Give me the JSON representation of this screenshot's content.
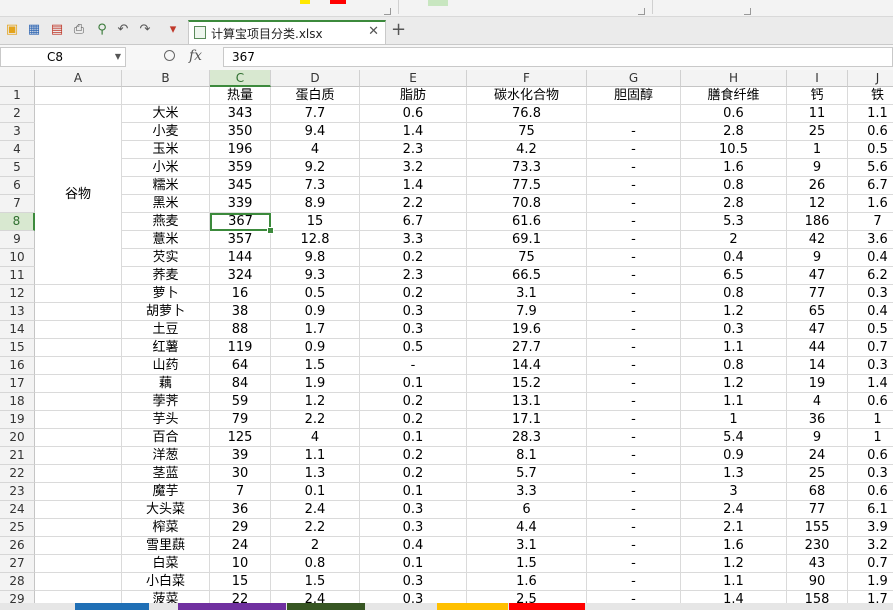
{
  "window": {
    "active_tab_title": "计算宝项目分类.xlsx"
  },
  "formula_bar": {
    "name_box": "C8",
    "fx_label": "fx",
    "formula_value": "367"
  },
  "grid": {
    "columns": [
      "A",
      "B",
      "C",
      "D",
      "E",
      "F",
      "G",
      "H",
      "I",
      "J"
    ],
    "active_column": "C",
    "active_row": 8,
    "header_row": [
      "",
      "",
      "热量",
      "蛋白质",
      "脂肪",
      "碳水化合物",
      "胆固醇",
      "膳食纤维",
      "钙",
      "铁"
    ],
    "category_label": "谷物",
    "rows": [
      {
        "num": 2,
        "name": "大米",
        "values": [
          "343",
          "7.7",
          "0.6",
          "76.8",
          "",
          "0.6",
          "11",
          "1.1"
        ]
      },
      {
        "num": 3,
        "name": "小麦",
        "values": [
          "350",
          "9.4",
          "1.4",
          "75",
          "-",
          "2.8",
          "25",
          "0.6"
        ]
      },
      {
        "num": 4,
        "name": "玉米",
        "values": [
          "196",
          "4",
          "2.3",
          "4.2",
          "-",
          "10.5",
          "1",
          "0.5"
        ]
      },
      {
        "num": 5,
        "name": "小米",
        "values": [
          "359",
          "9.2",
          "3.2",
          "73.3",
          "-",
          "1.6",
          "9",
          "5.6"
        ]
      },
      {
        "num": 6,
        "name": "糯米",
        "values": [
          "345",
          "7.3",
          "1.4",
          "77.5",
          "-",
          "0.8",
          "26",
          "6.7"
        ]
      },
      {
        "num": 7,
        "name": "黑米",
        "values": [
          "339",
          "8.9",
          "2.2",
          "70.8",
          "-",
          "2.8",
          "12",
          "1.6"
        ]
      },
      {
        "num": 8,
        "name": "燕麦",
        "values": [
          "367",
          "15",
          "6.7",
          "61.6",
          "-",
          "5.3",
          "186",
          "7"
        ]
      },
      {
        "num": 9,
        "name": "薏米",
        "values": [
          "357",
          "12.8",
          "3.3",
          "69.1",
          "-",
          "2",
          "42",
          "3.6"
        ]
      },
      {
        "num": 10,
        "name": "芡实",
        "values": [
          "144",
          "9.8",
          "0.2",
          "75",
          "-",
          "0.4",
          "9",
          "0.4"
        ]
      },
      {
        "num": 11,
        "name": "荞麦",
        "values": [
          "324",
          "9.3",
          "2.3",
          "66.5",
          "-",
          "6.5",
          "47",
          "6.2"
        ]
      },
      {
        "num": 12,
        "name": "萝卜",
        "values": [
          "16",
          "0.5",
          "0.2",
          "3.1",
          "-",
          "0.8",
          "77",
          "0.3"
        ]
      },
      {
        "num": 13,
        "name": "胡萝卜",
        "values": [
          "38",
          "0.9",
          "0.3",
          "7.9",
          "-",
          "1.2",
          "65",
          "0.4"
        ]
      },
      {
        "num": 14,
        "name": "土豆",
        "values": [
          "88",
          "1.7",
          "0.3",
          "19.6",
          "-",
          "0.3",
          "47",
          "0.5"
        ]
      },
      {
        "num": 15,
        "name": "红薯",
        "values": [
          "119",
          "0.9",
          "0.5",
          "27.7",
          "-",
          "1.1",
          "44",
          "0.7"
        ]
      },
      {
        "num": 16,
        "name": "山药",
        "values": [
          "64",
          "1.5",
          "-",
          "14.4",
          "-",
          "0.8",
          "14",
          "0.3"
        ]
      },
      {
        "num": 17,
        "name": "藕",
        "values": [
          "84",
          "1.9",
          "0.1",
          "15.2",
          "-",
          "1.2",
          "19",
          "1.4"
        ]
      },
      {
        "num": 18,
        "name": "荸荠",
        "values": [
          "59",
          "1.2",
          "0.2",
          "13.1",
          "-",
          "1.1",
          "4",
          "0.6"
        ]
      },
      {
        "num": 19,
        "name": "芋头",
        "values": [
          "79",
          "2.2",
          "0.2",
          "17.1",
          "-",
          "1",
          "36",
          "1"
        ]
      },
      {
        "num": 20,
        "name": "百合",
        "values": [
          "125",
          "4",
          "0.1",
          "28.3",
          "-",
          "5.4",
          "9",
          "1"
        ]
      },
      {
        "num": 21,
        "name": "洋葱",
        "values": [
          "39",
          "1.1",
          "0.2",
          "8.1",
          "-",
          "0.9",
          "24",
          "0.6"
        ]
      },
      {
        "num": 22,
        "name": "茎蓝",
        "values": [
          "30",
          "1.3",
          "0.2",
          "5.7",
          "-",
          "1.3",
          "25",
          "0.3"
        ]
      },
      {
        "num": 23,
        "name": "魔芋",
        "values": [
          "7",
          "0.1",
          "0.1",
          "3.3",
          "-",
          "3",
          "68",
          "0.6"
        ]
      },
      {
        "num": 24,
        "name": "大头菜",
        "values": [
          "36",
          "2.4",
          "0.3",
          "6",
          "-",
          "2.4",
          "77",
          "6.1"
        ]
      },
      {
        "num": 25,
        "name": "榨菜",
        "values": [
          "29",
          "2.2",
          "0.3",
          "4.4",
          "-",
          "2.1",
          "155",
          "3.9"
        ]
      },
      {
        "num": 26,
        "name": "雪里蕻",
        "values": [
          "24",
          "2",
          "0.4",
          "3.1",
          "-",
          "1.6",
          "230",
          "3.2"
        ]
      },
      {
        "num": 27,
        "name": "白菜",
        "values": [
          "10",
          "0.8",
          "0.1",
          "1.5",
          "-",
          "1.2",
          "43",
          "0.7"
        ]
      },
      {
        "num": 28,
        "name": "小白菜",
        "values": [
          "15",
          "1.5",
          "0.3",
          "1.6",
          "-",
          "1.1",
          "90",
          "1.9"
        ]
      },
      {
        "num": 29,
        "name": "菠菜",
        "values": [
          "22",
          "2.4",
          "0.3",
          "2.5",
          "-",
          "1.4",
          "158",
          "1.7"
        ]
      }
    ]
  },
  "colors": {
    "accent": "#3c8a3c",
    "sheet_tab_colors": [
      "#1f6fb5",
      "#7030a0",
      "#375623",
      "#ffc000",
      "#ff0000"
    ]
  }
}
